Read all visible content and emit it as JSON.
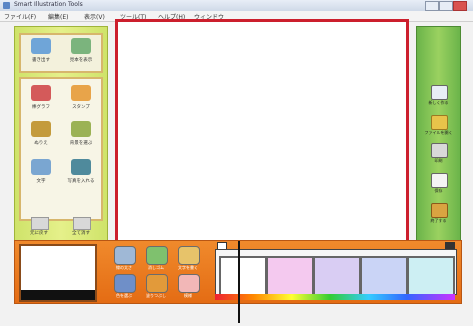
{
  "window": {
    "title": "Smart Illustration Tools"
  },
  "menu": {
    "items": [
      "ファイル(F)",
      "編集(E)",
      "表示(V)",
      "ツール(T)",
      "ヘルプ(H)",
      "ウィンドウ"
    ]
  },
  "left_panel": {
    "tools": [
      {
        "label": "書き出す",
        "icon": "picture-icon",
        "color": "#6fa5d8"
      },
      {
        "label": "見本を表示",
        "icon": "landscape-icon",
        "color": "#7bb47d"
      },
      {
        "label": "棒グラフ",
        "icon": "bars-icon",
        "color": "#d45a5a"
      },
      {
        "label": "スタンプ",
        "icon": "people-icon",
        "color": "#e8a44a"
      },
      {
        "label": "ぬりえ",
        "icon": "brush-icon",
        "color": "#c49b3c"
      },
      {
        "label": "背景を選ぶ",
        "icon": "figure-icon",
        "color": "#9bb255"
      },
      {
        "label": "文字",
        "icon": "shapes-icon",
        "color": "#7aa6d1"
      },
      {
        "label": "写真を入れる",
        "icon": "photo-icon",
        "color": "#4f8a9c"
      }
    ],
    "bottom_buttons": [
      {
        "label": "元に戻す",
        "icon": "undo-icon"
      },
      {
        "label": "全て消す",
        "icon": "clear-icon"
      }
    ]
  },
  "right_panel": {
    "buttons": [
      {
        "label": "新しく作る",
        "icon": "monitor-icon",
        "color": "#e8eef6"
      },
      {
        "label": "ファイルを開く",
        "icon": "folder-icon",
        "color": "#e8c34a"
      },
      {
        "label": "印刷",
        "icon": "printer-icon",
        "color": "#d9d9d9"
      },
      {
        "label": "保存",
        "icon": "document-icon",
        "color": "#f4f4f4"
      },
      {
        "label": "終了する",
        "icon": "door-icon",
        "color": "#d9a441"
      }
    ]
  },
  "bottom_panel": {
    "tools": [
      {
        "label": "線の太さ",
        "icon": "pen-icon",
        "color": "#9fb8d6"
      },
      {
        "label": "消しゴム",
        "icon": "disk-icon",
        "color": "#7fc16e"
      },
      {
        "label": "文字を書く",
        "icon": "face-icon",
        "color": "#e7c36a"
      },
      {
        "label": "色を選ぶ",
        "icon": "earth-icon",
        "color": "#6f8fc8"
      },
      {
        "label": "塗りつぶし",
        "icon": "globe-icon",
        "color": "#e29a3a"
      },
      {
        "label": "模様",
        "icon": "card-icon",
        "color": "#f2b7b7"
      }
    ],
    "thumbnail_colors": [
      "#ffffff",
      "#f4c9ef",
      "#d9cdf3",
      "#cad4f6",
      "#cdeff3"
    ]
  },
  "colors": {
    "canvas_border": "#cc1f2d",
    "left_panel": "#dbeb7a",
    "right_panel": "#86c457",
    "bottom_panel": "#ec7a1f"
  }
}
